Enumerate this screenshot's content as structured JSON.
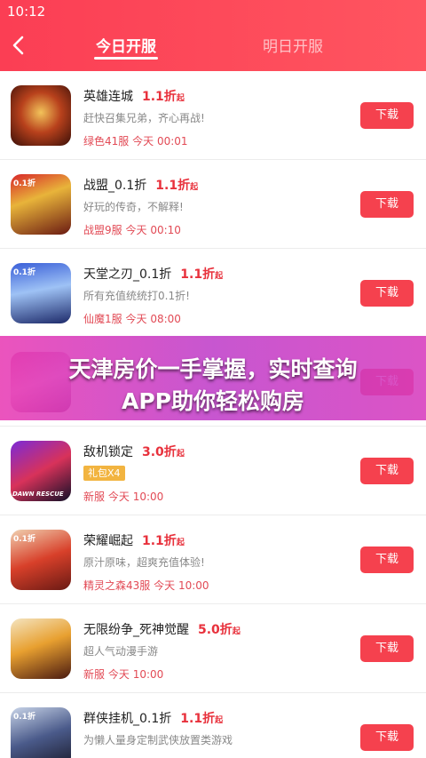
{
  "status_bar": {
    "time": "10:12"
  },
  "tabs": {
    "today": "今日开服",
    "tomorrow": "明日开服"
  },
  "colors": {
    "accent": "#f5414e",
    "header": "#fb3e54",
    "gift_badge": "#f2b440",
    "banner": "#d83cc0"
  },
  "games": [
    {
      "name": "英雄连城",
      "discount": "1.1折",
      "discount_suffix": "起",
      "desc": "赶快召集兄弟，齐心再战!",
      "server": "绿色41服",
      "day": "今天",
      "time": "00:01",
      "button": "下载",
      "icon": "hero-city-icon"
    },
    {
      "name": "战盟_0.1折",
      "discount": "1.1折",
      "discount_suffix": "起",
      "desc": "好玩的传奇，不解释!",
      "server": "战盟9服",
      "day": "今天",
      "time": "00:10",
      "button": "下载",
      "icon": "zhanmeng-icon",
      "icon_tag": "0.1折"
    },
    {
      "name": "天堂之刃_0.1折",
      "discount": "1.1折",
      "discount_suffix": "起",
      "desc": "所有充值统统打0.1折!",
      "server": "仙魔1服",
      "day": "今天",
      "time": "08:00",
      "button": "下载",
      "icon": "heaven-blade-icon",
      "icon_tag": "0.1折"
    },
    {
      "name": "",
      "discount": "",
      "discount_suffix": "",
      "desc": "",
      "server": "",
      "day": "",
      "time": "",
      "button": "下载",
      "icon": "obscured-game-icon"
    },
    {
      "name": "敌机锁定",
      "discount": "3.0折",
      "discount_suffix": "起",
      "gift": "礼包X4",
      "server": "新服",
      "day": "今天",
      "time": "10:00",
      "button": "下载",
      "icon": "dawn-rescue-icon",
      "icon_text": "DAWN RESCUE"
    },
    {
      "name": "荣耀崛起",
      "discount": "1.1折",
      "discount_suffix": "起",
      "desc": "原汁原味，超爽充值体验!",
      "server": "精灵之森43服",
      "day": "今天",
      "time": "10:00",
      "button": "下载",
      "icon": "glory-rise-icon",
      "icon_tag": "0.1折"
    },
    {
      "name": "无限纷争_死神觉醒",
      "discount": "5.0折",
      "discount_suffix": "起",
      "desc": "超人气动漫手游",
      "server": "新服",
      "day": "今天",
      "time": "10:00",
      "button": "下载",
      "icon": "bleach-icon"
    },
    {
      "name": "群侠挂机_0.1折",
      "discount": "1.1折",
      "discount_suffix": "起",
      "desc": "为懒人量身定制武侠放置类游戏",
      "server": "",
      "day": "",
      "time": "",
      "button": "下载",
      "icon": "heroes-idle-icon",
      "icon_tag": "0.1折"
    }
  ],
  "banner": {
    "line1": "天津房价一手掌握，实时查询",
    "line2": "APP助你轻松购房"
  }
}
